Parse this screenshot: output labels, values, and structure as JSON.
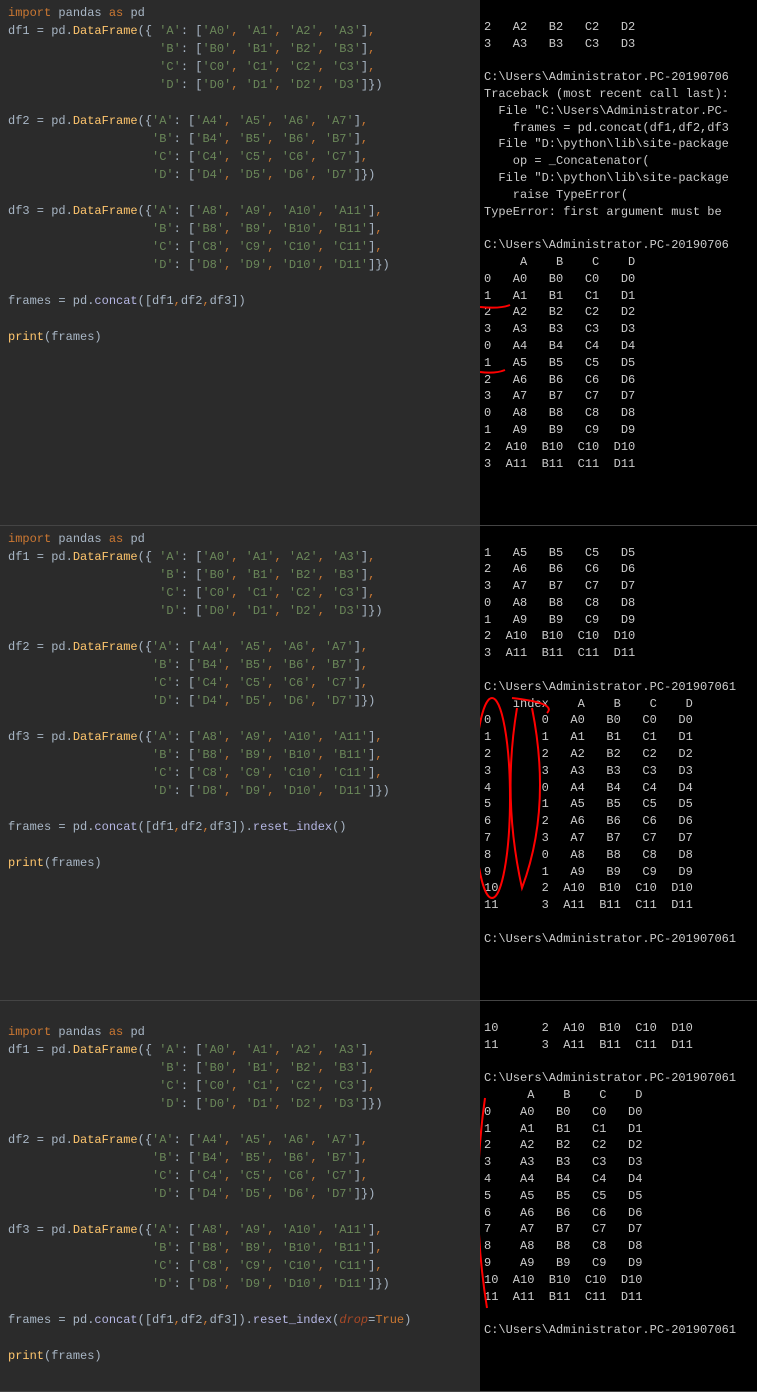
{
  "sections": [
    {
      "code": {
        "import": "import pandas as pd",
        "df1": {
          "name": "df1",
          "call": "pd.DataFrame",
          "rows": [
            "{ 'A': ['A0', 'A1', 'A2', 'A3'],",
            "  'B': ['B0', 'B1', 'B2', 'B3'],",
            "  'C': ['C0', 'C1', 'C2', 'C3'],",
            "  'D': ['D0', 'D1', 'D2', 'D3']})"
          ]
        },
        "df2": {
          "name": "df2",
          "call": "pd.DataFrame",
          "rows": [
            "{'A': ['A4', 'A5', 'A6', 'A7'],",
            " 'B': ['B4', 'B5', 'B6', 'B7'],",
            " 'C': ['C4', 'C5', 'C6', 'C7'],",
            " 'D': ['D4', 'D5', 'D6', 'D7']})"
          ]
        },
        "df3": {
          "name": "df3",
          "call": "pd.DataFrame",
          "rows": [
            "{'A': ['A8', 'A9', 'A10', 'A11'],",
            " 'B': ['B8', 'B9', 'B10', 'B11'],",
            " 'C': ['C8', 'C9', 'C10', 'C11'],",
            " 'D': ['D8', 'D9', 'D10', 'D11']})"
          ]
        },
        "concat": "frames = pd.concat([df1,df2,df3])",
        "print": "print(frames)"
      },
      "output": {
        "pre_lines": [
          "2   A2   B2   C2   D2",
          "3   A3   B3   C3   D3",
          "",
          "C:\\Users\\Administrator.PC-20190706",
          "Traceback (most recent call last):",
          "  File \"C:\\Users\\Administrator.PC-",
          "    frames = pd.concat(df1,df2,df3",
          "  File \"D:\\python\\lib\\site-package",
          "    op = _Concatenator(",
          "  File \"D:\\python\\lib\\site-package",
          "    raise TypeError(",
          "TypeError: first argument must be ",
          "",
          "C:\\Users\\Administrator.PC-20190706"
        ],
        "header": "     A    B    C    D",
        "rows": [
          "0   A0   B0   C0   D0",
          "1   A1   B1   C1   D1",
          "2   A2   B2   C2   D2",
          "3   A3   B3   C3   D3",
          "0   A4   B4   C4   D4",
          "1   A5   B5   C5   D5",
          "2   A6   B6   C6   D6",
          "3   A7   B7   C7   D7",
          "0   A8   B8   C8   D8",
          "1   A9   B9   C9   D9",
          "2  A10  B10  C10  D10",
          "3  A11  B11  C11  D11"
        ]
      }
    },
    {
      "code": {
        "import": "import pandas as pd",
        "df1": {
          "name": "df1",
          "call": "pd.DataFrame",
          "rows": [
            "{ 'A': ['A0', 'A1', 'A2', 'A3'],",
            "  'B': ['B0', 'B1', 'B2', 'B3'],",
            "  'C': ['C0', 'C1', 'C2', 'C3'],",
            "  'D': ['D0', 'D1', 'D2', 'D3']})"
          ]
        },
        "df2": {
          "name": "df2",
          "call": "pd.DataFrame",
          "rows": [
            "{'A': ['A4', 'A5', 'A6', 'A7'],",
            " 'B': ['B4', 'B5', 'B6', 'B7'],",
            " 'C': ['C4', 'C5', 'C6', 'C7'],",
            " 'D': ['D4', 'D5', 'D6', 'D7']})"
          ]
        },
        "df3": {
          "name": "df3",
          "call": "pd.DataFrame",
          "rows": [
            "{'A': ['A8', 'A9', 'A10', 'A11'],",
            " 'B': ['B8', 'B9', 'B10', 'B11'],",
            " 'C': ['C8', 'C9', 'C10', 'C11'],",
            " 'D': ['D8', 'D9', 'D10', 'D11']})"
          ]
        },
        "concat": "frames = pd.concat([df1,df2,df3]).reset_index()",
        "print": "print(frames)"
      },
      "output": {
        "pre_lines": [
          "1   A5   B5   C5   D5",
          "2   A6   B6   C6   D6",
          "3   A7   B7   C7   D7",
          "0   A8   B8   C8   D8",
          "1   A9   B9   C9   D9",
          "2  A10  B10  C10  D10",
          "3  A11  B11  C11  D11",
          "",
          "C:\\Users\\Administrator.PC-201907061"
        ],
        "header": "    index    A    B    C    D",
        "rows": [
          "0       0   A0   B0   C0   D0",
          "1       1   A1   B1   C1   D1",
          "2       2   A2   B2   C2   D2",
          "3       3   A3   B3   C3   D3",
          "4       0   A4   B4   C4   D4",
          "5       1   A5   B5   C5   D5",
          "6       2   A6   B6   C6   D6",
          "7       3   A7   B7   C7   D7",
          "8       0   A8   B8   C8   D8",
          "9       1   A9   B9   C9   D9",
          "10      2  A10  B10  C10  D10",
          "11      3  A11  B11  C11  D11"
        ],
        "post_lines": [
          "",
          "C:\\Users\\Administrator.PC-201907061"
        ]
      }
    },
    {
      "code": {
        "import": "import pandas as pd",
        "df1": {
          "name": "df1",
          "call": "pd.DataFrame",
          "rows": [
            "{ 'A': ['A0', 'A1', 'A2', 'A3'],",
            "  'B': ['B0', 'B1', 'B2', 'B3'],",
            "  'C': ['C0', 'C1', 'C2', 'C3'],",
            "  'D': ['D0', 'D1', 'D2', 'D3']})"
          ]
        },
        "df2": {
          "name": "df2",
          "call": "pd.DataFrame",
          "rows": [
            "{'A': ['A4', 'A5', 'A6', 'A7'],",
            " 'B': ['B4', 'B5', 'B6', 'B7'],",
            " 'C': ['C4', 'C5', 'C6', 'C7'],",
            " 'D': ['D4', 'D5', 'D6', 'D7']})"
          ]
        },
        "df3": {
          "name": "df3",
          "call": "pd.DataFrame",
          "rows": [
            "{'A': ['A8', 'A9', 'A10', 'A11'],",
            " 'B': ['B8', 'B9', 'B10', 'B11'],",
            " 'C': ['C8', 'C9', 'C10', 'C11'],",
            " 'D': ['D8', 'D9', 'D10', 'D11']})"
          ]
        },
        "concat": "frames = pd.concat([df1,df2,df3]).reset_index(drop=True)",
        "print": "print(frames)"
      },
      "output": {
        "pre_lines": [
          "10      2  A10  B10  C10  D10",
          "11      3  A11  B11  C11  D11",
          "",
          "C:\\Users\\Administrator.PC-201907061"
        ],
        "header": "      A    B    C    D",
        "rows": [
          "0    A0   B0   C0   D0",
          "1    A1   B1   C1   D1",
          "2    A2   B2   C2   D2",
          "3    A3   B3   C3   D3",
          "4    A4   B4   C4   D4",
          "5    A5   B5   C5   D5",
          "6    A6   B6   C6   D6",
          "7    A7   B7   C7   D7",
          "8    A8   B8   C8   D8",
          "9    A9   B9   C9   D9",
          "10  A10  B10  C10  D10",
          "11  A11  B11  C11  D11"
        ],
        "post_lines": [
          "",
          "C:\\Users\\Administrator.PC-201907061"
        ]
      }
    }
  ]
}
